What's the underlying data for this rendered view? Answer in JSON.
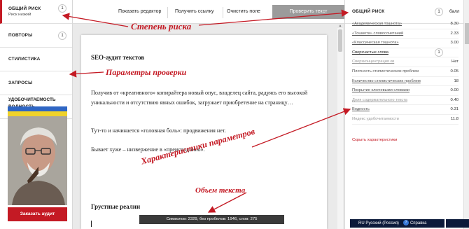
{
  "sidebar": {
    "items": [
      {
        "title": "ОБЩИЙ РИСК",
        "sub": "Риск низкий",
        "badge": "1"
      },
      {
        "title": "ПОВТОРЫ",
        "badge": "1"
      },
      {
        "title": "СТИЛИСТИКА"
      },
      {
        "title": "ЗАПРОСЫ"
      },
      {
        "title": "ВОДНОСТЬ"
      }
    ],
    "section_label": "УДОБОЧИТАЕМОСТЬ",
    "order_button": "Заказать аудит"
  },
  "toolbar": {
    "show_editor": "Показать редактор",
    "get_link": "Получить ссылку",
    "clear_field": "Очистить поле",
    "check_text": "Проверить текст"
  },
  "document": {
    "heading": "SEO-аудит текстов",
    "paragraph1": "Получив от «креативного» копирайтера новый опус, владелец сайта, радуясь его высокой уникальности и отсутствию явных ошибок, загружает приобретение на страницу…",
    "paragraph2": "Тут-то и начинается «головная боль»: продвижения нет.",
    "paragraph3": "Бывает хуже – низвержение в «преисподнюю».",
    "subheading": "Грустные реалии",
    "counter": "Символов: 2329, без пробелов: 1946, слов: 275"
  },
  "right_panel": {
    "title": "ОБЩИЙ РИСК",
    "badge": "1",
    "unit": "балл",
    "metrics": [
      {
        "name": "«Академическая тошнота»",
        "value": "8.30",
        "style": "link"
      },
      {
        "name": "«Тошнота» словосочетаний",
        "value": "2.33",
        "style": "link"
      },
      {
        "name": "«Классическая тошнота»",
        "value": "3.00",
        "style": "link"
      },
      {
        "name": "Сверхчастые слова",
        "value": "1",
        "style": "link dark",
        "badge": true
      },
      {
        "name": "Сверхконцентрация ки",
        "value": "Нет",
        "style": "link gray"
      },
      {
        "name": "Плотность стилистических проблем",
        "value": "0.05",
        "style": ""
      },
      {
        "name": "Количество стилистических проблем",
        "value": "18",
        "style": "link"
      },
      {
        "name": "Покрытие ключевыми словами",
        "value": "0.00",
        "style": "link"
      },
      {
        "name": "Доля содержательного текста",
        "value": "0.40",
        "style": "link gray"
      },
      {
        "name": "Водность",
        "value": "0.31",
        "style": "link"
      },
      {
        "name": "Индекс удобочитаемости",
        "value": "11.8",
        "style": "gray"
      }
    ],
    "hide_link": "Скрыть характеристики"
  },
  "taskbar": {
    "lang": "RU Русский (Россия)",
    "help": "Справка",
    "help_icon": "?"
  },
  "annotations": {
    "risk_degree": "Степень риска",
    "check_params": "Параметры проверки",
    "param_characteristics": "Характеристики параметров",
    "text_volume": "Объем текста"
  },
  "colors": {
    "accent": "#c41a24",
    "check_button": "#9b9b9b",
    "flag_blue": "#2f66c4",
    "flag_yellow": "#f0d22a"
  }
}
